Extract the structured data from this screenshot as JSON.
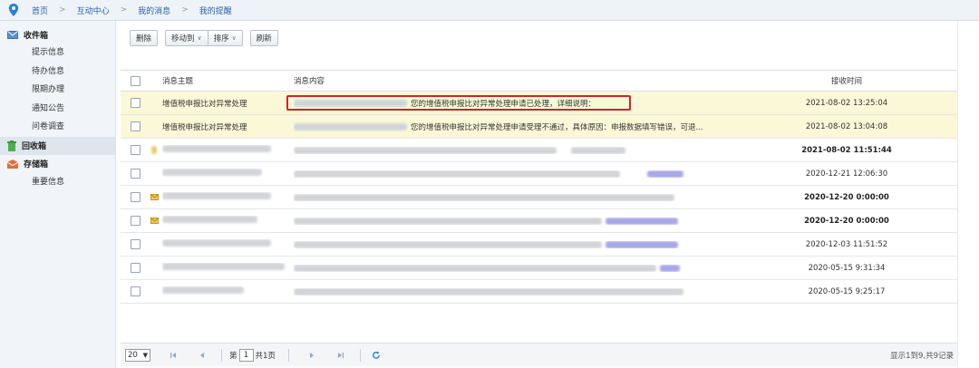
{
  "breadcrumb": [
    "首页",
    "互动中心",
    "我的消息",
    "我的提醒"
  ],
  "sidebar": {
    "inbox": {
      "label": "收件箱",
      "items": [
        "提示信息",
        "待办信息",
        "限期办理",
        "通知公告",
        "问卷调查"
      ]
    },
    "recycle": {
      "label": "回收箱"
    },
    "storage": {
      "label": "存储箱",
      "items": [
        "重要信息"
      ]
    }
  },
  "toolbar": {
    "delete": "删除",
    "move": "移动到",
    "sort": "排序",
    "refresh": "刷新"
  },
  "table": {
    "headers": {
      "subject": "消息主题",
      "content": "消息内容",
      "time": "接收时间"
    },
    "rows": [
      {
        "subject": "增值税申报比对异常处理",
        "content": "您的增值税申报比对异常处理申请已处理，详细说明：",
        "time": "2021-08-02 13:25:04",
        "bold": false,
        "highlight": true,
        "icon": "none"
      },
      {
        "subject": "增值税申报比对异常处理",
        "content": "您的增值税申报比对异常处理申请受理不通过，具体原因：申报数据填写错误，可退...",
        "time": "2021-08-02 13:04:08",
        "bold": false,
        "highlight": true,
        "icon": "none"
      },
      {
        "subject": "",
        "content": "",
        "time": "2021-08-02 11:51:44",
        "bold": true,
        "highlight": false,
        "icon": "none"
      },
      {
        "subject": "",
        "content": "",
        "time": "2020-12-21 12:06:30",
        "bold": false,
        "highlight": false,
        "icon": "none"
      },
      {
        "subject": "",
        "content": "",
        "time": "2020-12-20 0:00:00",
        "bold": true,
        "highlight": false,
        "icon": "mail-icon"
      },
      {
        "subject": "",
        "content": "",
        "time": "2020-12-20 0:00:00",
        "bold": true,
        "highlight": false,
        "icon": "mail-icon"
      },
      {
        "subject": "",
        "content": "",
        "time": "2020-12-03 11:51:52",
        "bold": false,
        "highlight": false,
        "icon": "none"
      },
      {
        "subject": "",
        "content": "",
        "time": "2020-05-15 9:31:34",
        "bold": false,
        "highlight": false,
        "icon": "none"
      },
      {
        "subject": "",
        "content": "",
        "time": "2020-05-15 9:25:17",
        "bold": false,
        "highlight": false,
        "icon": "none"
      }
    ]
  },
  "pager": {
    "page_size": "20",
    "page_prefix": "第",
    "page_value": "1",
    "page_suffix": "共1页",
    "summary": "显示1到9,共9记录"
  },
  "colors": {
    "highlight": "#fbf8d8",
    "annotation": "#c9262c",
    "link": "#2b5fa6"
  }
}
